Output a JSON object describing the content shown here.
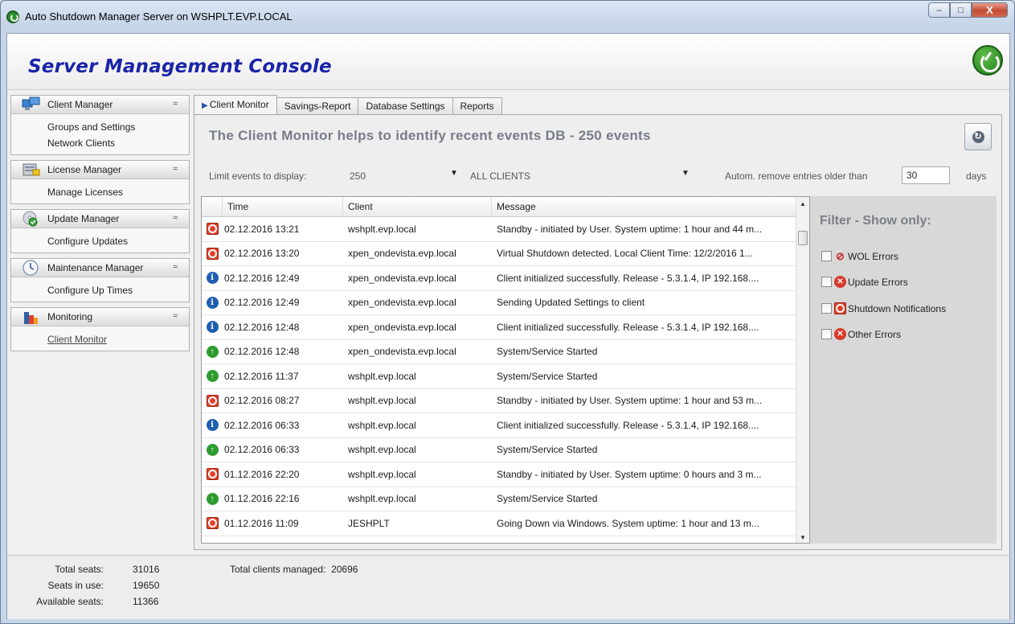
{
  "window": {
    "title": "Auto Shutdown Manager Server on WSHPLT.EVP.LOCAL",
    "minimize": "–",
    "maximize": "□",
    "close": "X"
  },
  "header": {
    "title": "Server Management Console"
  },
  "sidebar": {
    "groups": [
      {
        "label": "Client Manager",
        "items": [
          "Groups and Settings",
          "Network Clients"
        ]
      },
      {
        "label": "License Manager",
        "items": [
          "Manage Licenses"
        ]
      },
      {
        "label": "Update  Manager",
        "items": [
          "Configure Updates"
        ]
      },
      {
        "label": "Maintenance Manager",
        "items": [
          "Configure Up Times"
        ]
      },
      {
        "label": "Monitoring",
        "items": [
          "Client Monitor"
        ]
      }
    ],
    "chevron": "≈"
  },
  "tabs": [
    "Client Monitor",
    "Savings-Report",
    "Database Settings",
    "Reports"
  ],
  "monitor": {
    "heading": "The Client Monitor helps to identify recent events DB - 250 events",
    "limit_label": "Limit events to display:",
    "limit_value": "250",
    "clients_value": "ALL CLIENTS",
    "remove_label": "Autom. remove entries older than",
    "remove_value": "30",
    "days_label": "days"
  },
  "grid": {
    "columns": [
      "Time",
      "Client",
      "Message"
    ],
    "rows": [
      {
        "type": "stop",
        "time": "02.12.2016 13:21",
        "client": "wshplt.evp.local",
        "message": "Standby - initiated by User. System uptime: 1 hour and 44 m..."
      },
      {
        "type": "stop",
        "time": "02.12.2016 13:20",
        "client": "xpen_ondevista.evp.local",
        "message": "Virtual Shutdown detected. Local Client Time: 12/2/2016 1..."
      },
      {
        "type": "info",
        "time": "02.12.2016 12:49",
        "client": "xpen_ondevista.evp.local",
        "message": "Client initialized successfully. Release - 5.3.1.4, IP 192.168...."
      },
      {
        "type": "info",
        "time": "02.12.2016 12:49",
        "client": "xpen_ondevista.evp.local",
        "message": "Sending Updated Settings to client"
      },
      {
        "type": "info",
        "time": "02.12.2016 12:48",
        "client": "xpen_ondevista.evp.local",
        "message": "Client initialized successfully. Release - 5.3.1.4, IP 192.168...."
      },
      {
        "type": "start",
        "time": "02.12.2016 12:48",
        "client": "xpen_ondevista.evp.local",
        "message": "System/Service Started"
      },
      {
        "type": "start",
        "time": "02.12.2016 11:37",
        "client": "wshplt.evp.local",
        "message": "System/Service Started"
      },
      {
        "type": "stop",
        "time": "02.12.2016 08:27",
        "client": "wshplt.evp.local",
        "message": "Standby - initiated by User. System uptime: 1 hour and 53 m..."
      },
      {
        "type": "info",
        "time": "02.12.2016 06:33",
        "client": "wshplt.evp.local",
        "message": "Client initialized successfully. Release - 5.3.1.4, IP 192.168...."
      },
      {
        "type": "start",
        "time": "02.12.2016 06:33",
        "client": "wshplt.evp.local",
        "message": "System/Service Started"
      },
      {
        "type": "stop",
        "time": "01.12.2016 22:20",
        "client": "wshplt.evp.local",
        "message": "Standby - initiated by User. System uptime: 0 hours and 3 m..."
      },
      {
        "type": "start",
        "time": "01.12.2016 22:16",
        "client": "wshplt.evp.local",
        "message": "System/Service Started"
      },
      {
        "type": "stop",
        "time": "01.12.2016 11:09",
        "client": "JESHPLT",
        "message": "Going Down via Windows. System uptime: 1 hour and 13 m..."
      }
    ]
  },
  "filter": {
    "title": "Filter - Show only:",
    "items": [
      "WOL Errors",
      "Update Errors",
      "Shutdown Notifications",
      "Other Errors"
    ]
  },
  "status": {
    "total_seats_label": "Total seats:",
    "total_seats": "31016",
    "seats_in_use_label": "Seats in use:",
    "seats_in_use": "19650",
    "available_label": "Available seats:",
    "available": "11366",
    "managed_label": "Total clients managed:",
    "managed": "20696"
  }
}
